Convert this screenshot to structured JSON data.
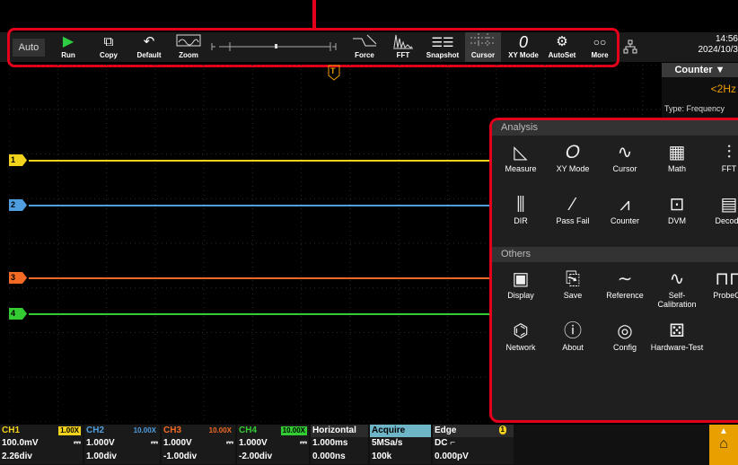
{
  "top_marker_color": "#e4001b",
  "toolbar": {
    "auto_label": "Auto",
    "run_label": "Run",
    "copy_label": "Copy",
    "default_label": "Default",
    "zoom_label": "Zoom",
    "force_label": "Force",
    "fft_label": "FFT",
    "snapshot_label": "Snapshot",
    "cursor_label": "Cursor",
    "xymode_label": "XY Mode",
    "autoset_label": "AutoSet",
    "more_label": "More"
  },
  "clock": {
    "time": "14:56",
    "date": "2024/10/3"
  },
  "trigger_marker": "T",
  "counter": {
    "title": "Counter",
    "value": "<2Hz",
    "type_label": "Type: Frequency"
  },
  "channels": [
    {
      "label": "1",
      "color": "#f2d21a"
    },
    {
      "label": "2",
      "color": "#4f9fe0"
    },
    {
      "label": "3",
      "color": "#f26a24"
    },
    {
      "label": "4",
      "color": "#33cc33"
    }
  ],
  "menu": {
    "analysis_title": "Analysis",
    "others_title": "Others",
    "analysis_items": [
      {
        "label": "Measure",
        "icon": "measure-icon"
      },
      {
        "label": "XY Mode",
        "icon": "xy-mode-icon"
      },
      {
        "label": "Cursor",
        "icon": "cursor-icon"
      },
      {
        "label": "Math",
        "icon": "math-icon"
      },
      {
        "label": "FFT",
        "icon": "fft-icon"
      },
      {
        "label": "DIR",
        "icon": "dir-icon"
      },
      {
        "label": "Pass Fail",
        "icon": "pass-fail-icon"
      },
      {
        "label": "Counter",
        "icon": "counter-icon"
      },
      {
        "label": "DVM",
        "icon": "dvm-icon"
      },
      {
        "label": "Decode",
        "icon": "decode-icon"
      }
    ],
    "others_items": [
      {
        "label": "Display",
        "icon": "display-icon"
      },
      {
        "label": "Save",
        "icon": "save-icon"
      },
      {
        "label": "Reference",
        "icon": "reference-icon"
      },
      {
        "label": "Self-Calibration",
        "icon": "self-calibration-icon"
      },
      {
        "label": "ProbeCh",
        "icon": "probe-check-icon"
      },
      {
        "label": "Network",
        "icon": "network-icon"
      },
      {
        "label": "About",
        "icon": "about-icon"
      },
      {
        "label": "Config",
        "icon": "config-icon"
      },
      {
        "label": "Hardware-Test",
        "icon": "hardware-test-icon"
      }
    ]
  },
  "bottom": {
    "ch1": {
      "name": "CH1",
      "probe": "1.00X",
      "volts": "100.0mV",
      "coupling": "⎓",
      "pos": "2.26div"
    },
    "ch2": {
      "name": "CH2",
      "probe": "10.00X",
      "volts": "1.000V",
      "coupling": "⎓",
      "pos": "1.00div"
    },
    "ch3": {
      "name": "CH3",
      "probe": "10.00X",
      "volts": "1.000V",
      "coupling": "⎓",
      "pos": "-1.00div"
    },
    "ch4": {
      "name": "CH4",
      "probe": "10.00X",
      "volts": "1.000V",
      "coupling": "⎓",
      "pos": "-2.00div"
    },
    "horizontal": {
      "name": "Horizontal",
      "timebase": "1.000ms",
      "delay": "0.000ns"
    },
    "acquire": {
      "name": "Acquire",
      "rate": "5MSa/s",
      "depth": "100k"
    },
    "edge": {
      "name": "Edge",
      "source": "1",
      "coupling": "DC",
      "level": "0.000pV"
    }
  }
}
